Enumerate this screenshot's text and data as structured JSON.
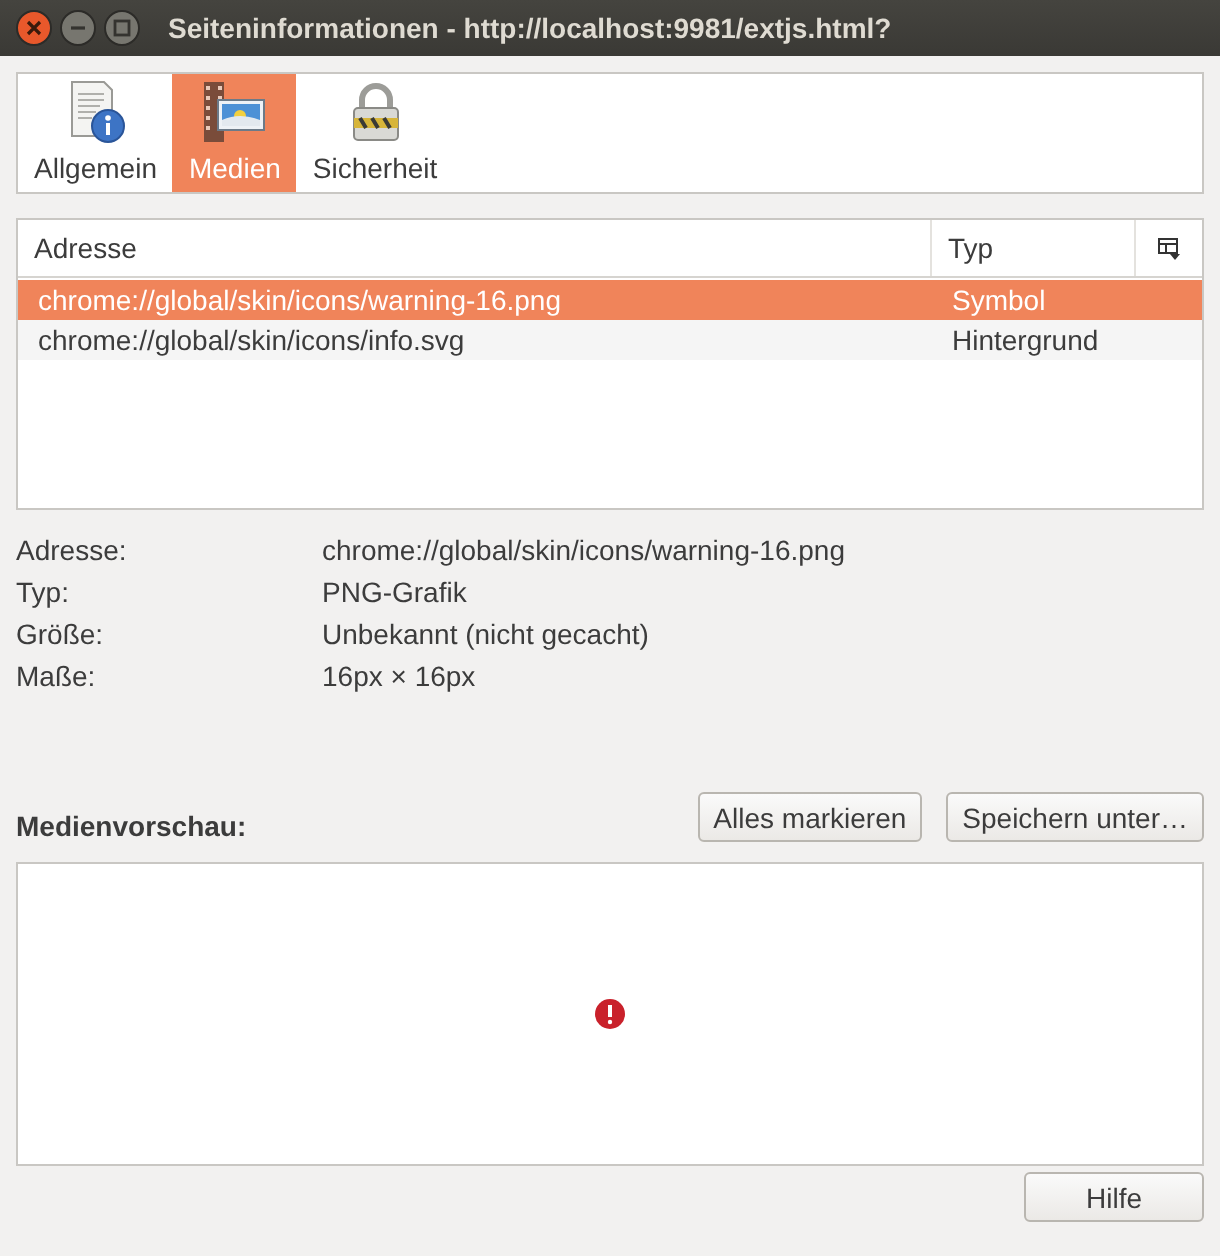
{
  "window": {
    "title": "Seiteninformationen - http://localhost:9981/extjs.html?"
  },
  "tabs": [
    {
      "label": "Allgemein",
      "kind": "general",
      "selected": false
    },
    {
      "label": "Medien",
      "kind": "media",
      "selected": true
    },
    {
      "label": "Sicherheit",
      "kind": "security",
      "selected": false
    }
  ],
  "table": {
    "columns": [
      "Adresse",
      "Typ"
    ],
    "rows": [
      {
        "cells": [
          "chrome://global/skin/icons/warning-16.png",
          "Symbol"
        ],
        "selected": true
      },
      {
        "cells": [
          "chrome://global/skin/icons/info.svg",
          "Hintergrund"
        ],
        "selected": false
      }
    ]
  },
  "details": [
    {
      "label": "Adresse:",
      "value": "chrome://global/skin/icons/warning-16.png"
    },
    {
      "label": "Typ:",
      "value": "PNG-Grafik"
    },
    {
      "label": "Größe:",
      "value": "Unbekannt (nicht gecacht)"
    },
    {
      "label": "Maße:",
      "value": "16px × 16px"
    }
  ],
  "preview": {
    "label": "Medienvorschau:",
    "buttons": [
      "Alles markieren",
      "Speichern unter…"
    ]
  },
  "footer_buttons": [
    "Hilfe"
  ]
}
